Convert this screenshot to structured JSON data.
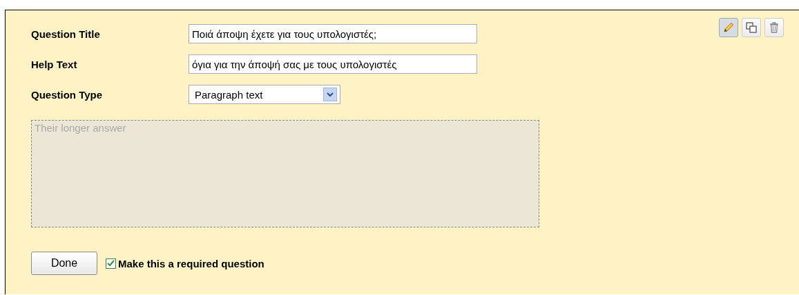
{
  "tools": [
    {
      "kind": "edit",
      "pressed": true
    },
    {
      "kind": "duplicate",
      "pressed": false
    },
    {
      "kind": "delete",
      "pressed": false
    }
  ],
  "fields": [
    {
      "label": "Question Title",
      "kind": "text",
      "value": "Ποιά άποψη έχετε για τους υπολογιστές;"
    },
    {
      "label": "Help Text",
      "kind": "text",
      "value": "όγια για την άποψή σας με τους υπολογιστές"
    },
    {
      "label": "Question Type",
      "kind": "select",
      "value": "Paragraph text"
    }
  ],
  "answer_preview": {
    "placeholder": "Their longer answer"
  },
  "done_button": "Done",
  "required": {
    "label": "Make this a required question",
    "checked": true
  }
}
